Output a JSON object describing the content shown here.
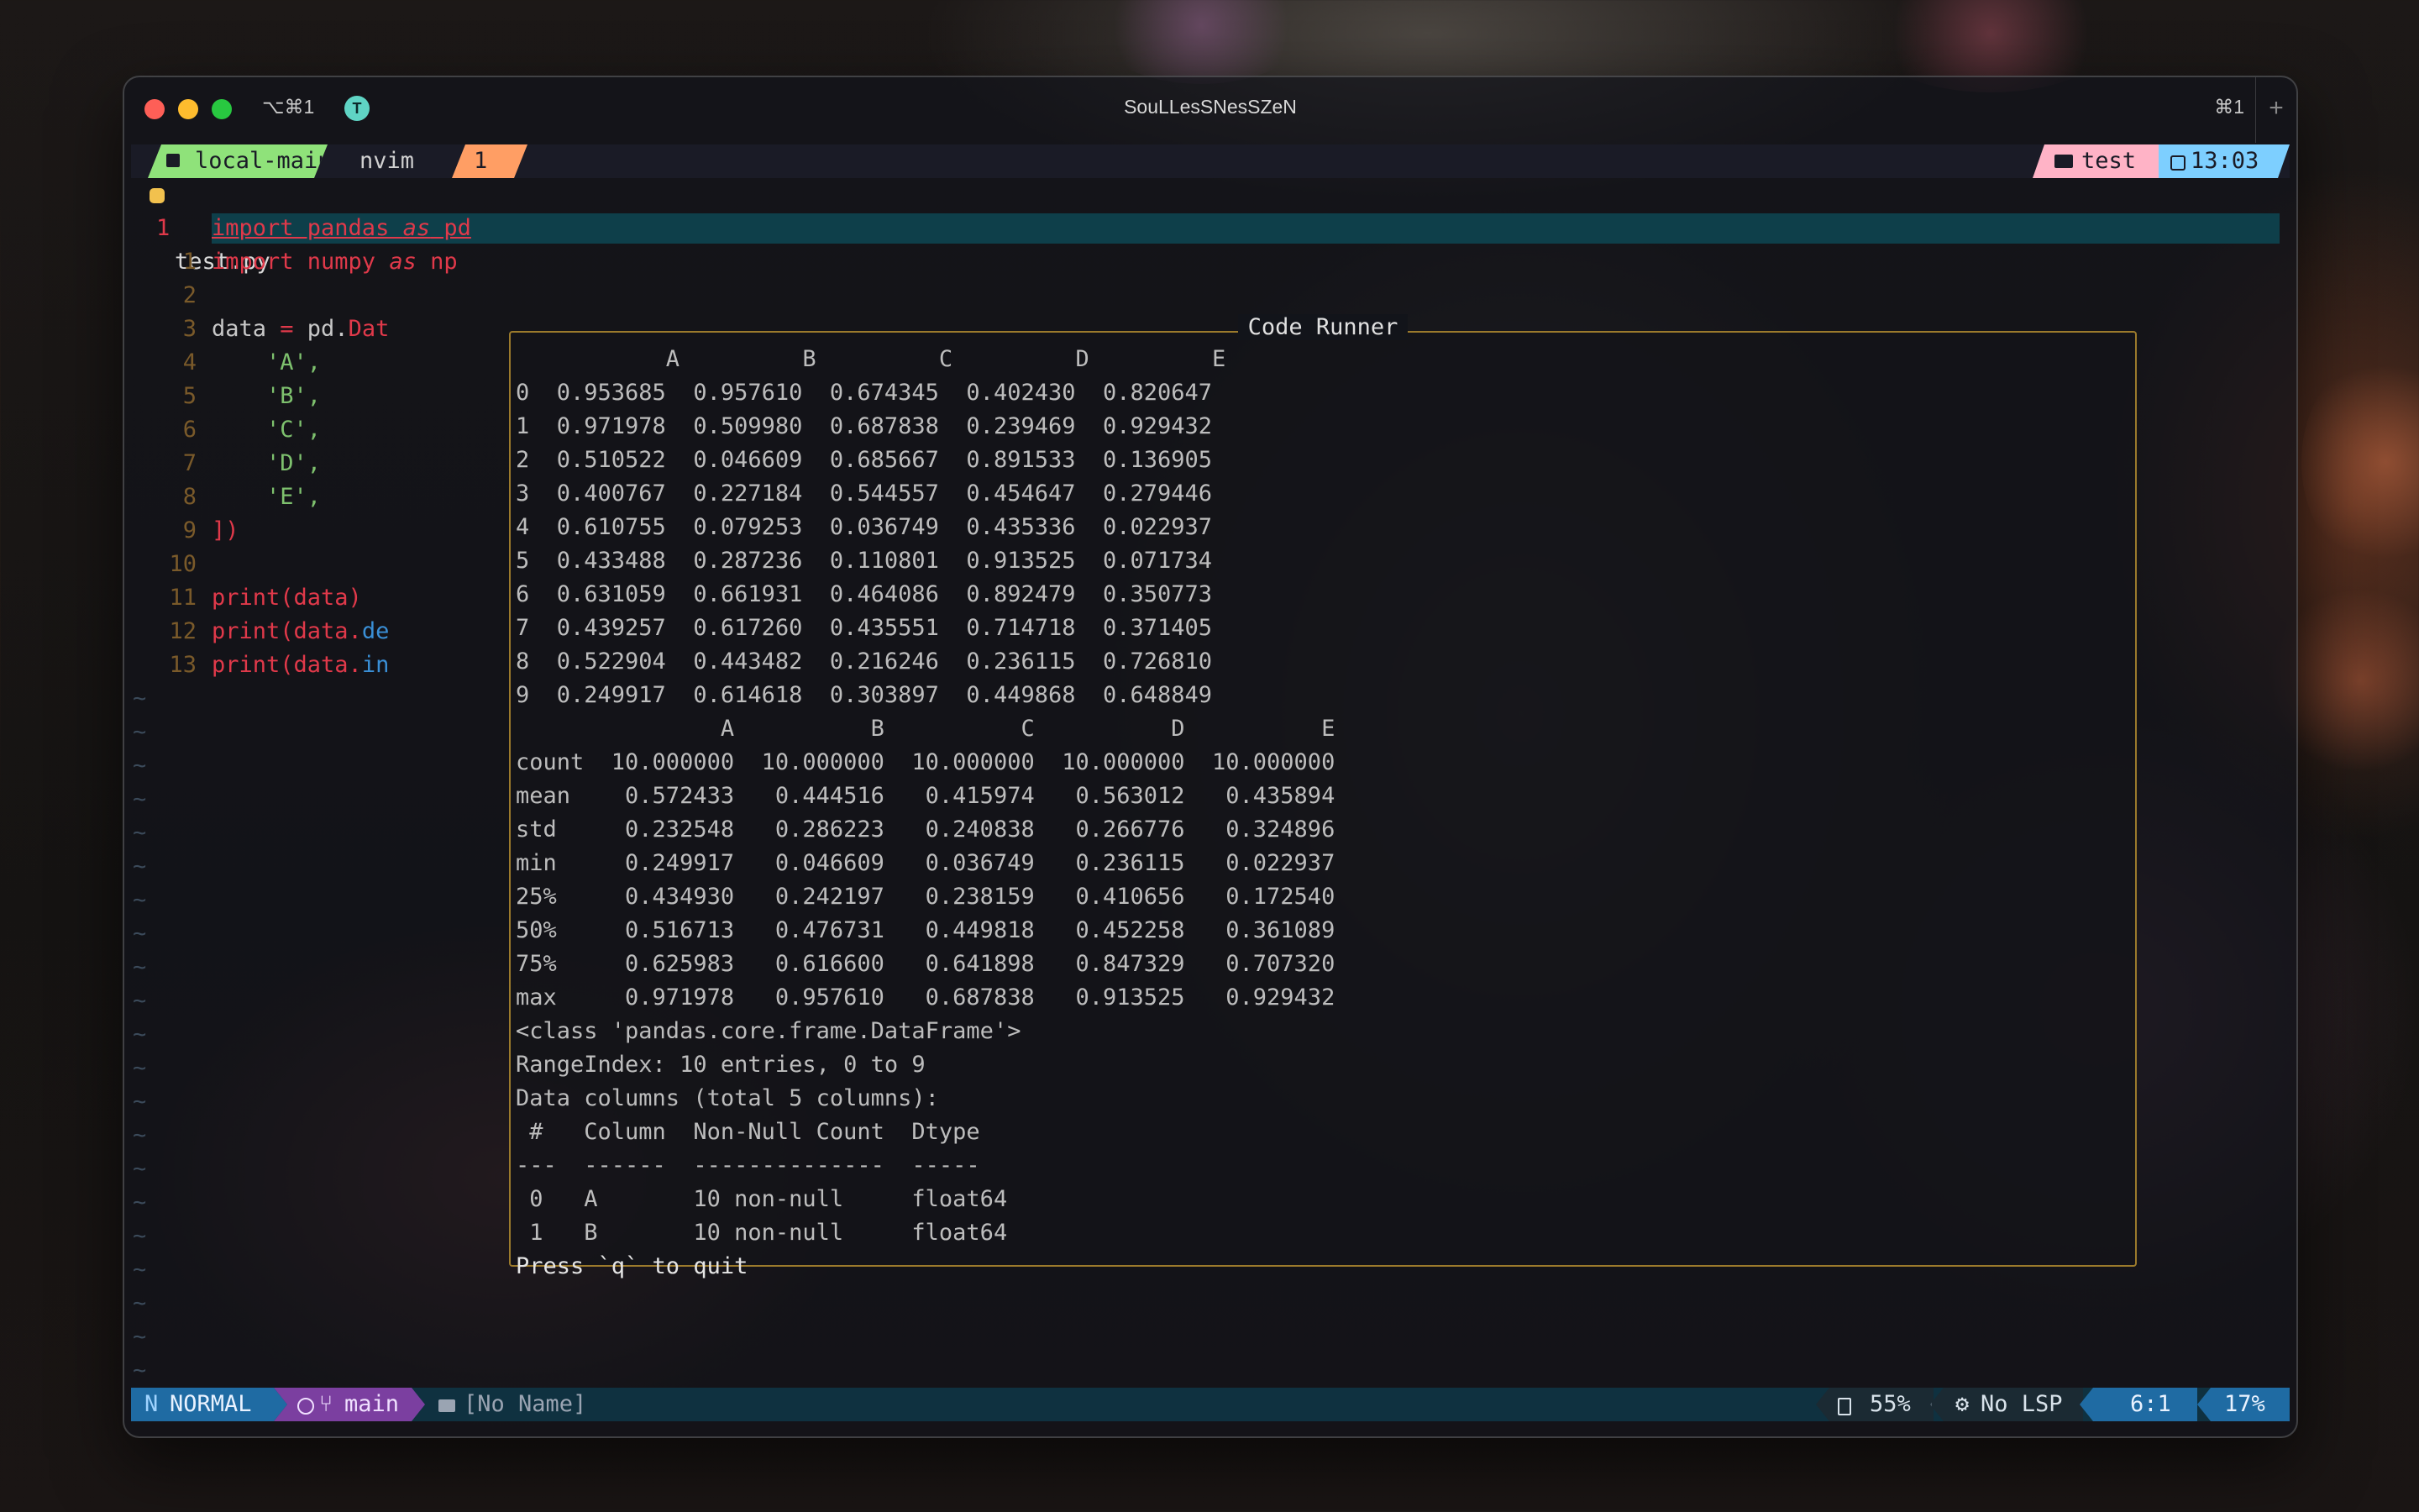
{
  "window": {
    "title": "SouLLesSNesSZeN",
    "left_shortcut": "⌥⌘1",
    "badge": "T",
    "right_shortcut": "⌘1",
    "plus": "+"
  },
  "tmux": {
    "session": "local-main",
    "program": "nvim",
    "window_index": "1",
    "folder": "test",
    "time": "13:03"
  },
  "editor": {
    "file": "test.py",
    "cursor_line_number": "1",
    "lines": [
      {
        "num": "1",
        "parts": [
          {
            "t": "import pandas ",
            "c": "#e0394a"
          },
          {
            "t": "as",
            "c": "#e0394a",
            "i": true
          },
          {
            "t": " pd",
            "c": "#e0394a"
          }
        ],
        "cursor": true
      },
      {
        "num": "1",
        "parts": [
          {
            "t": "import numpy ",
            "c": "#e0394a"
          },
          {
            "t": "as",
            "c": "#e0394a",
            "i": true
          },
          {
            "t": " np",
            "c": "#e0394a"
          }
        ]
      },
      {
        "num": "2",
        "parts": []
      },
      {
        "num": "3",
        "parts": [
          {
            "t": "data ",
            "c": "#c8c8c8"
          },
          {
            "t": "=",
            "c": "#e0394a"
          },
          {
            "t": " pd.",
            "c": "#c8c8c8"
          },
          {
            "t": "Dat",
            "c": "#e0394a"
          }
        ]
      },
      {
        "num": "4",
        "parts": [
          {
            "t": "    'A',",
            "c": "#7ec16e"
          }
        ]
      },
      {
        "num": "5",
        "parts": [
          {
            "t": "    'B',",
            "c": "#7ec16e"
          }
        ]
      },
      {
        "num": "6",
        "parts": [
          {
            "t": "    'C',",
            "c": "#7ec16e"
          }
        ]
      },
      {
        "num": "7",
        "parts": [
          {
            "t": "    'D',",
            "c": "#7ec16e"
          }
        ]
      },
      {
        "num": "8",
        "parts": [
          {
            "t": "    'E',",
            "c": "#7ec16e"
          }
        ]
      },
      {
        "num": "9",
        "parts": [
          {
            "t": "])",
            "c": "#e0394a"
          }
        ]
      },
      {
        "num": "10",
        "parts": []
      },
      {
        "num": "11",
        "parts": [
          {
            "t": "print",
            "c": "#e0394a"
          },
          {
            "t": "(data)",
            "c": "#e0394a"
          }
        ]
      },
      {
        "num": "12",
        "parts": [
          {
            "t": "print",
            "c": "#e0394a"
          },
          {
            "t": "(data.",
            "c": "#e0394a"
          },
          {
            "t": "de",
            "c": "#3a8fd6"
          }
        ]
      },
      {
        "num": "13",
        "parts": [
          {
            "t": "print",
            "c": "#e0394a"
          },
          {
            "t": "(data.",
            "c": "#e0394a"
          },
          {
            "t": "in",
            "c": "#3a8fd6"
          }
        ]
      }
    ],
    "tilde": "~",
    "tilde_count": 21
  },
  "runner": {
    "title": "Code Runner",
    "output": [
      "           A         B         C         D         E",
      "0  0.953685  0.957610  0.674345  0.402430  0.820647",
      "1  0.971978  0.509980  0.687838  0.239469  0.929432",
      "2  0.510522  0.046609  0.685667  0.891533  0.136905",
      "3  0.400767  0.227184  0.544557  0.454647  0.279446",
      "4  0.610755  0.079253  0.036749  0.435336  0.022937",
      "5  0.433488  0.287236  0.110801  0.913525  0.071734",
      "6  0.631059  0.661931  0.464086  0.892479  0.350773",
      "7  0.439257  0.617260  0.435551  0.714718  0.371405",
      "8  0.522904  0.443482  0.216246  0.236115  0.726810",
      "9  0.249917  0.614618  0.303897  0.449868  0.648849",
      "               A          B          C          D          E",
      "count  10.000000  10.000000  10.000000  10.000000  10.000000",
      "mean    0.572433   0.444516   0.415974   0.563012   0.435894",
      "std     0.232548   0.286223   0.240838   0.266776   0.324896",
      "min     0.249917   0.046609   0.036749   0.236115   0.022937",
      "25%     0.434930   0.242197   0.238159   0.410656   0.172540",
      "50%     0.516713   0.476731   0.449818   0.452258   0.361089",
      "75%     0.625983   0.616600   0.641898   0.847329   0.707320",
      "max     0.971978   0.957610   0.687838   0.913525   0.929432",
      "<class 'pandas.core.frame.DataFrame'>",
      "RangeIndex: 10 entries, 0 to 9",
      "Data columns (total 5 columns):",
      " #   Column  Non-Null Count  Dtype  ",
      "---  ------  --------------  -----  ",
      " 0   A       10 non-null     float64",
      " 1   B       10 non-null     float64",
      "Press `q` to quit"
    ]
  },
  "statusline": {
    "mode": "NORMAL",
    "branch": "main",
    "buffer": "[No Name]",
    "battery": "55%",
    "lsp": "No LSP",
    "position": "6:1",
    "percent": "17%"
  },
  "colors": {
    "accent_green": "#8fe27a",
    "accent_orange": "#ff9e64",
    "accent_pink": "#ffb3c6",
    "accent_blue": "#7dcfff",
    "runner_border": "#9b7a2c",
    "keyword_red": "#e0394a"
  }
}
